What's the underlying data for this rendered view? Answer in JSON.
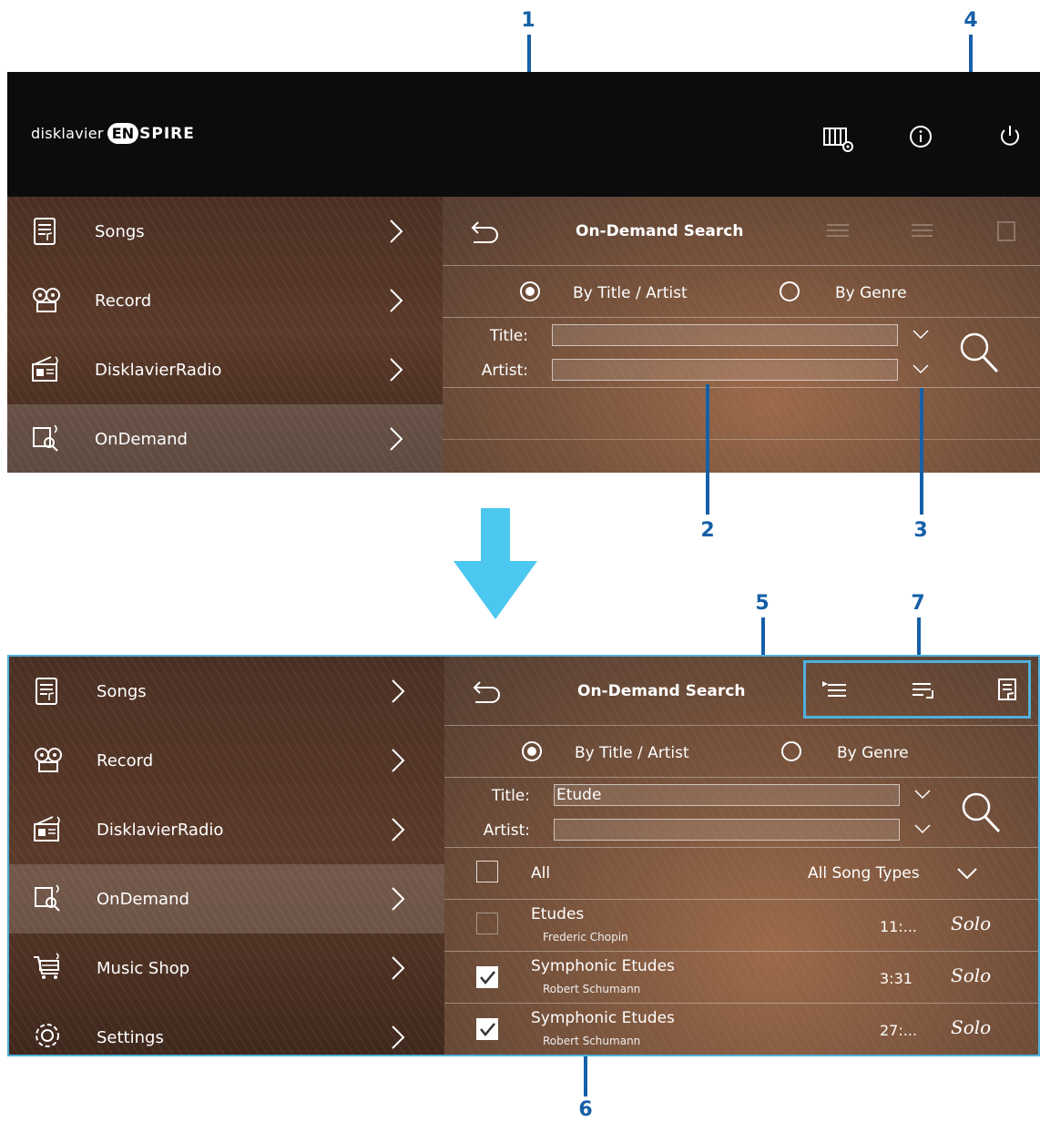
{
  "callouts": {
    "c1": "1",
    "c2": "2",
    "c3": "3",
    "c4": "4",
    "c5": "5",
    "c6": "6",
    "c7": "7"
  },
  "top_bar": {
    "logo_prefix": "disklavier",
    "logo_badge": "EN",
    "logo_suffix": "SPIRE"
  },
  "nav_top": [
    {
      "label": "Songs",
      "icon": "songs-icon"
    },
    {
      "label": "Record",
      "icon": "record-icon"
    },
    {
      "label": "DisklavierRadio",
      "icon": "radio-icon"
    },
    {
      "label": "OnDemand",
      "icon": "ondemand-icon"
    }
  ],
  "nav_bottom": [
    {
      "label": "Songs",
      "icon": "songs-icon"
    },
    {
      "label": "Record",
      "icon": "record-icon"
    },
    {
      "label": "DisklavierRadio",
      "icon": "radio-icon"
    },
    {
      "label": "OnDemand",
      "icon": "ondemand-icon"
    },
    {
      "label": "Music Shop",
      "icon": "cart-icon"
    },
    {
      "label": "Settings",
      "icon": "gear-icon"
    }
  ],
  "search": {
    "title": "On-Demand Search",
    "by_title_artist": "By Title / Artist",
    "by_genre": "By Genre",
    "title_label": "Title:",
    "artist_label": "Artist:",
    "title_value_top": "",
    "title_value_bottom": "Etude",
    "artist_value": ""
  },
  "results": {
    "all_label": "All",
    "song_types": "All Song Types",
    "songs": [
      {
        "title": "Etudes",
        "artist": "Frederic Chopin",
        "time": "11:...",
        "type": "Solo",
        "checked": false
      },
      {
        "title": "Symphonic Etudes",
        "artist": "Robert Schumann",
        "time": "3:31",
        "type": "Solo",
        "checked": true
      },
      {
        "title": "Symphonic Etudes",
        "artist": "Robert Schumann",
        "time": "27:...",
        "type": "Solo",
        "checked": true
      }
    ]
  },
  "colors": {
    "callout": "#1560a8",
    "arrow": "#4cc8f0",
    "frame": "#4fb0dc"
  }
}
